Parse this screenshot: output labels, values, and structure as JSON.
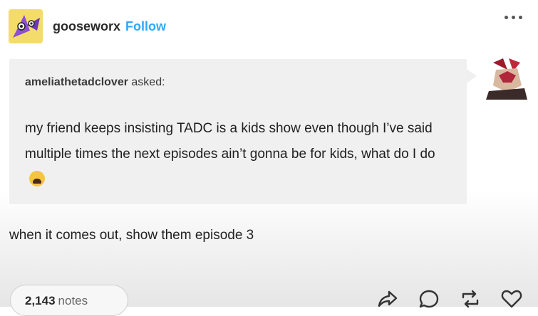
{
  "post": {
    "blog_name": "gooseworx",
    "follow_label": "Follow"
  },
  "ask": {
    "asker_name": "ameliathetadclover",
    "asked_label": "asked:",
    "question": "my friend keeps insisting TADC is a kids show even though I’ve said multiple times the next episodes ain’t gonna be for kids, what do I do"
  },
  "answer": {
    "text": "when it comes out, show them episode 3"
  },
  "footer": {
    "notes_count": "2,143",
    "notes_label": "notes"
  },
  "icons": {
    "more": "more-horizontal-icon",
    "share": "share-icon",
    "reply": "reply-icon",
    "reblog": "reblog-icon",
    "like": "heart-icon",
    "emoji": "crying-face-emoji"
  },
  "colors": {
    "follow": "#2fa8ff",
    "ask_bg": "#f0f0f0"
  }
}
